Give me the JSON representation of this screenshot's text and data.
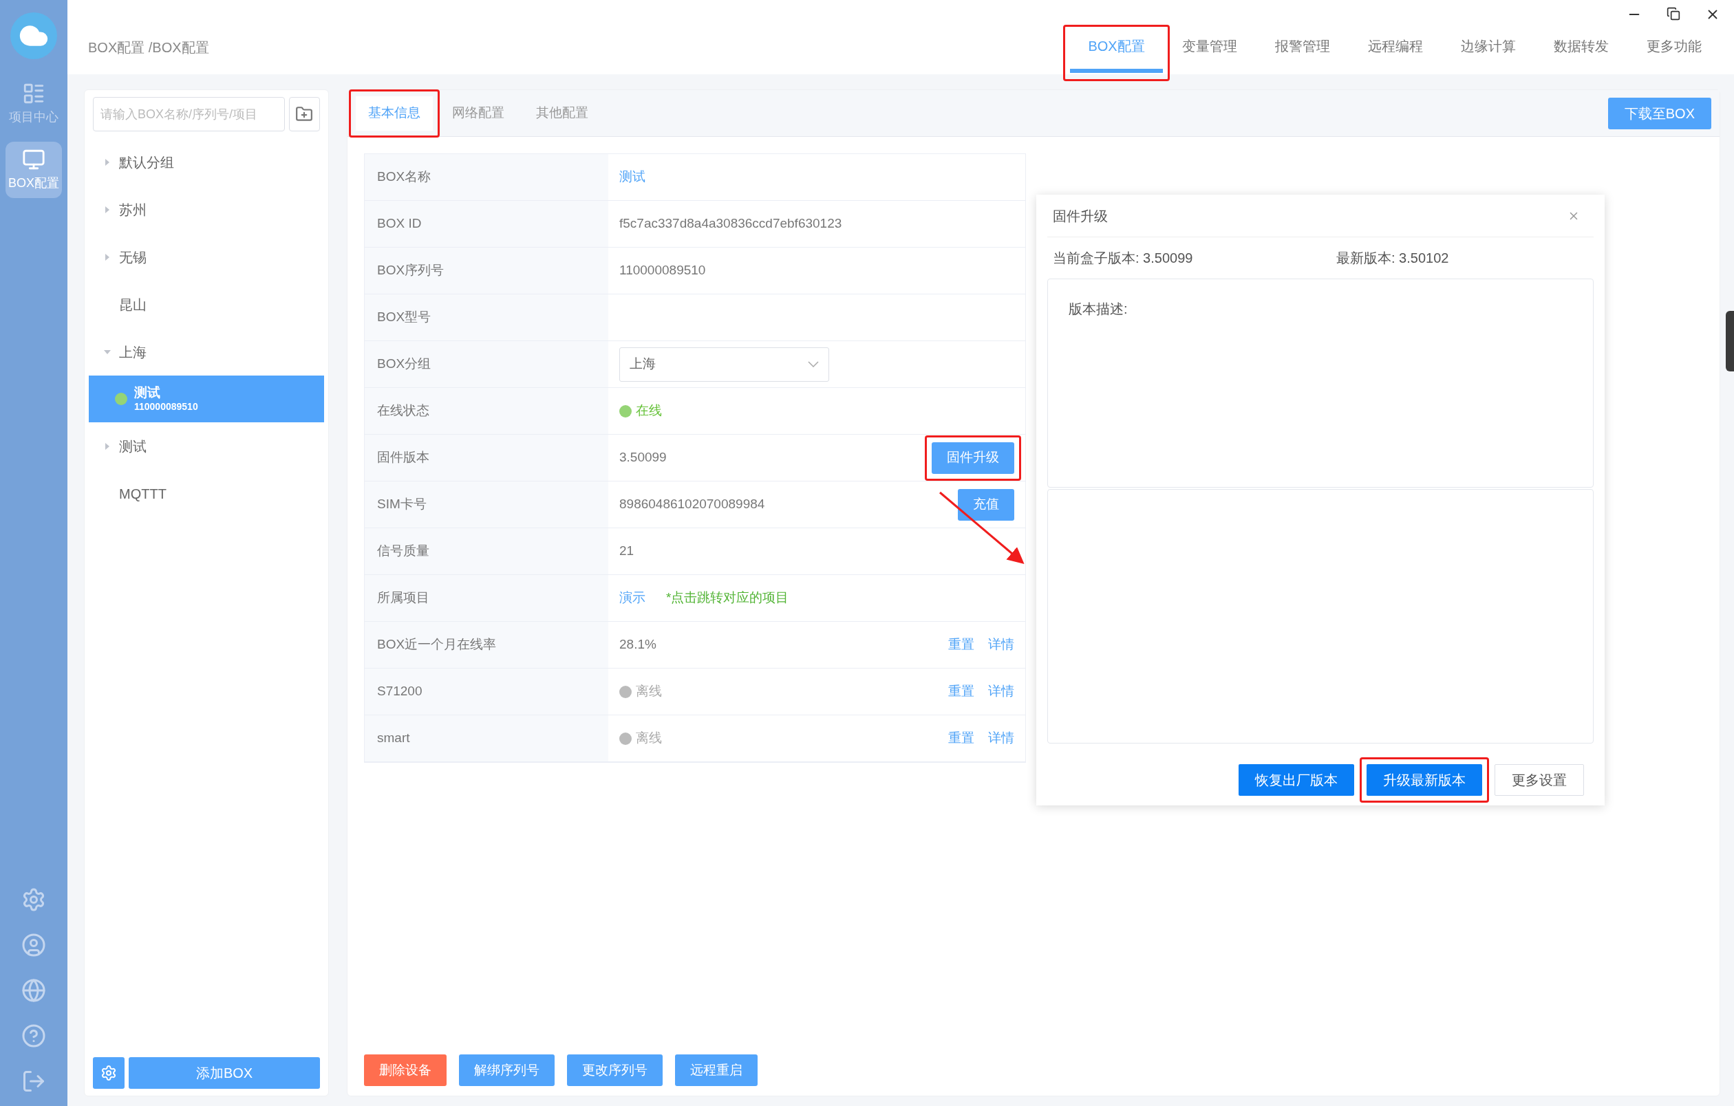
{
  "rail": {
    "items": [
      {
        "label": "项目中心",
        "kind": "list",
        "selected": false
      },
      {
        "label": "BOX配置",
        "kind": "monitor",
        "selected": true
      }
    ]
  },
  "breadcrumb": "BOX配置 /BOX配置",
  "top_tabs": [
    {
      "label": "BOX配置",
      "selected": true,
      "highlighted": true
    },
    {
      "label": "变量管理",
      "selected": false
    },
    {
      "label": "报警管理",
      "selected": false
    },
    {
      "label": "远程编程",
      "selected": false
    },
    {
      "label": "边缘计算",
      "selected": false
    },
    {
      "label": "数据转发",
      "selected": false
    },
    {
      "label": "更多功能",
      "selected": false
    }
  ],
  "tree": {
    "search_placeholder": "请输入BOX名称/序列号/项目",
    "groups": [
      {
        "label": "默认分组",
        "kind": "collapsible",
        "expanded": false
      },
      {
        "label": "苏州",
        "kind": "collapsible",
        "expanded": false
      },
      {
        "label": "无锡",
        "kind": "collapsible",
        "expanded": false
      },
      {
        "label": "昆山",
        "kind": "plain"
      },
      {
        "label": "上海",
        "kind": "collapsible",
        "expanded": true,
        "children": [
          {
            "name": "测试",
            "serial": "110000089510",
            "online": true,
            "selected": true
          }
        ]
      },
      {
        "label": "测试",
        "kind": "collapsible",
        "expanded": false
      },
      {
        "label": "MQTTT",
        "kind": "plain"
      }
    ],
    "add_button": "添加BOX"
  },
  "main_tabs": [
    {
      "label": "基本信息",
      "selected": true,
      "highlighted": true
    },
    {
      "label": "网络配置",
      "selected": false
    },
    {
      "label": "其他配置",
      "selected": false
    }
  ],
  "download_button": "下载至BOX",
  "rows": [
    {
      "label": "BOX名称",
      "kind": "link",
      "value": "测试"
    },
    {
      "label": "BOX ID",
      "kind": "text",
      "value": "f5c7ac337d8a4a30836ccd7ebf630123"
    },
    {
      "label": "BOX序列号",
      "kind": "text",
      "value": "110000089510"
    },
    {
      "label": "BOX型号",
      "kind": "text"
    },
    {
      "label": "BOX分组",
      "kind": "select",
      "value": "上海"
    },
    {
      "label": "在线状态",
      "kind": "status",
      "value": "在线",
      "online": true
    },
    {
      "label": "固件版本",
      "kind": "text",
      "value": "3.50099",
      "button": {
        "label": "固件升级",
        "highlighted": true
      }
    },
    {
      "label": "SIM卡号",
      "kind": "text",
      "value": "89860486102070089984",
      "button": {
        "label": "充值"
      }
    },
    {
      "label": "信号质量",
      "kind": "text",
      "value": "21"
    },
    {
      "label": "所属项目",
      "kind": "project",
      "value": "演示",
      "note": "*点击跳转对应的项目"
    },
    {
      "label": "BOX近一个月在线率",
      "kind": "text",
      "value": "28.1%",
      "actions": [
        "重置",
        "详情"
      ]
    },
    {
      "label": "S71200",
      "kind": "status",
      "value": "离线",
      "online": false,
      "actions": [
        "重置",
        "详情"
      ]
    },
    {
      "label": "smart",
      "kind": "status",
      "value": "离线",
      "online": false,
      "actions": [
        "重置",
        "详情"
      ]
    }
  ],
  "bottom_buttons": [
    {
      "label": "删除设备",
      "kind": "danger"
    },
    {
      "label": "解绑序列号",
      "kind": "primary"
    },
    {
      "label": "更改序列号",
      "kind": "primary"
    },
    {
      "label": "远程重启",
      "kind": "primary"
    }
  ],
  "dialog": {
    "title": "固件升级",
    "current_version": "当前盒子版本: 3.50099",
    "latest_version": "最新版本: 3.50102",
    "description_label": "版本描述:",
    "buttons": [
      {
        "label": "恢复出厂版本",
        "kind": "primary"
      },
      {
        "label": "升级最新版本",
        "kind": "primary",
        "highlighted": true
      },
      {
        "label": "更多设置",
        "kind": "default"
      }
    ]
  }
}
